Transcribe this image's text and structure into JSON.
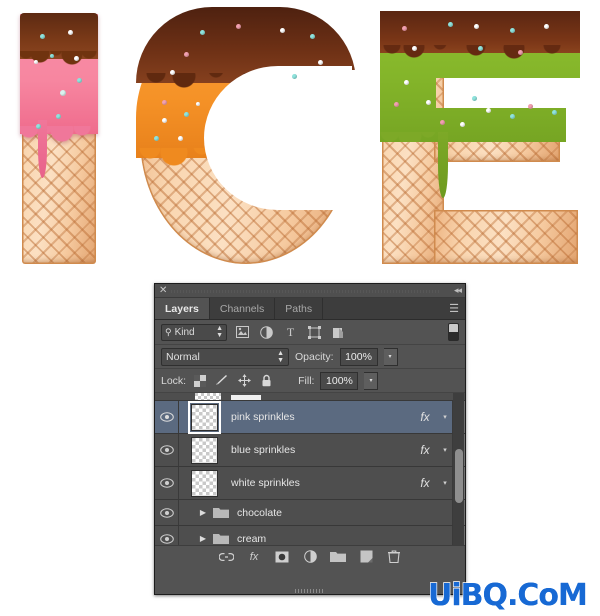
{
  "artwork": {
    "title": "ICE",
    "letters": [
      {
        "glyph": "I",
        "icing_color": "#f78fa7",
        "icing_name": "pink strawberry icing",
        "topping": "chocolate drip",
        "base": "waffle cone"
      },
      {
        "glyph": "C",
        "icing_color": "#f59227",
        "icing_name": "orange caramel icing",
        "topping": "chocolate drip",
        "base": "waffle cone"
      },
      {
        "glyph": "E",
        "icing_color": "#84b52a",
        "icing_name": "green pistachio icing",
        "topping": "chocolate drip",
        "base": "waffle cone"
      }
    ],
    "sprinkle_colors": [
      "#ffffff",
      "#8fe3dd",
      "#f2a0b0",
      "#f7d08a"
    ]
  },
  "panel": {
    "titlebar": {
      "close_label": "✕",
      "collapse_label": "◂◂"
    },
    "tabs": [
      {
        "label": "Layers",
        "active": true
      },
      {
        "label": "Channels",
        "active": false
      },
      {
        "label": "Paths",
        "active": false
      }
    ],
    "tab_menu_label": "☰",
    "filter": {
      "search_icon": "search-icon",
      "kind_label": "Kind",
      "stepper_label": "↕",
      "buttons": [
        {
          "name": "filter-pixel-layers",
          "glyph": "❑"
        },
        {
          "name": "filter-adjustment-layers",
          "glyph": "◑"
        },
        {
          "name": "filter-type-layers",
          "glyph": "T"
        },
        {
          "name": "filter-shape-layers",
          "glyph": "⬚"
        },
        {
          "name": "filter-smart-objects",
          "glyph": "❐"
        }
      ],
      "toggle_name": "filter-enable-toggle"
    },
    "blend": {
      "mode": "Normal",
      "stepper_label": "↕",
      "opacity_label": "Opacity:",
      "opacity_value": "100%",
      "arrow_label": "▾"
    },
    "lock": {
      "label": "Lock:",
      "icons": [
        {
          "name": "lock-transparent-pixels-icon",
          "glyph": "checker"
        },
        {
          "name": "lock-image-pixels-icon",
          "glyph": "brush"
        },
        {
          "name": "lock-position-icon",
          "glyph": "move"
        },
        {
          "name": "lock-all-icon",
          "glyph": "lock"
        }
      ],
      "fill_label": "Fill:",
      "fill_value": "100%",
      "arrow_label": "▾"
    },
    "layers": [
      {
        "name": "pink sprinkles",
        "type": "layer",
        "visible": true,
        "selected": true,
        "has_fx": true,
        "fx_label": "fx",
        "fx_arrow": "▾"
      },
      {
        "name": "blue sprinkles",
        "type": "layer",
        "visible": true,
        "selected": false,
        "has_fx": true,
        "fx_label": "fx",
        "fx_arrow": "▾"
      },
      {
        "name": "white sprinkles",
        "type": "layer",
        "visible": true,
        "selected": false,
        "has_fx": true,
        "fx_label": "fx",
        "fx_arrow": "▾"
      },
      {
        "name": "chocolate",
        "type": "group",
        "visible": true,
        "selected": false,
        "has_fx": false,
        "expand_arrow": "▶"
      },
      {
        "name": "cream",
        "type": "group",
        "visible": true,
        "selected": false,
        "has_fx": false,
        "expand_arrow": "▶"
      }
    ],
    "bottom_buttons": [
      {
        "name": "link-layers-button",
        "glyph": "⚭"
      },
      {
        "name": "layer-style-fx-button",
        "glyph": "fx"
      },
      {
        "name": "add-layer-mask-button",
        "glyph": "◉"
      },
      {
        "name": "new-adjustment-layer-button",
        "glyph": "◑"
      },
      {
        "name": "new-group-button",
        "glyph": "🗀"
      },
      {
        "name": "new-layer-button",
        "glyph": "◰"
      },
      {
        "name": "delete-layer-button",
        "glyph": "🗑"
      }
    ],
    "selected_row_color": "#5b6a80"
  },
  "watermark": {
    "text": "UiBQ.CoM",
    "color": "#1769d4"
  }
}
